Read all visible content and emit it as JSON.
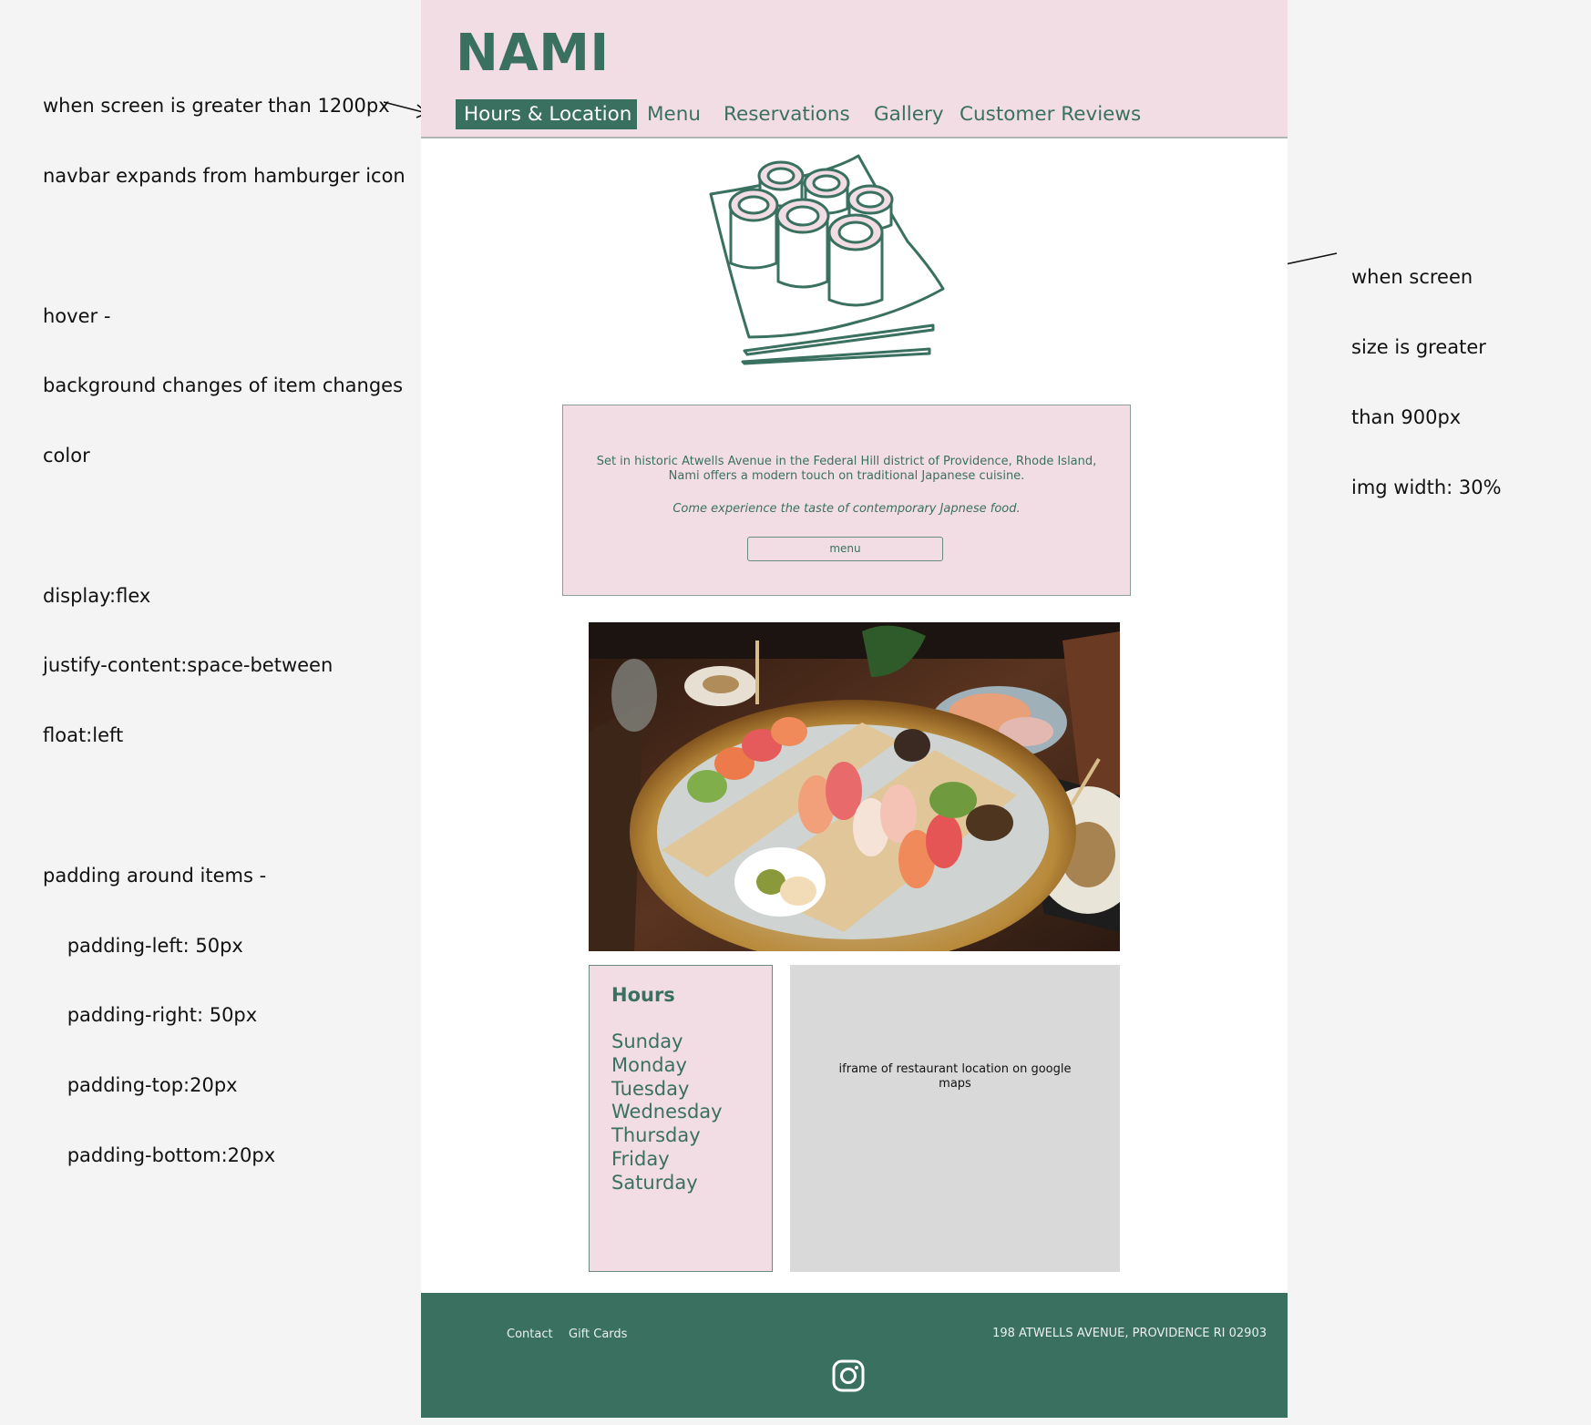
{
  "annotations": {
    "left": [
      "when screen is greater than 1200px",
      "navbar expands from hamburger icon",
      "",
      "hover -",
      "background changes of item changes",
      "color",
      "",
      "display:flex",
      "justify-content:space-between",
      "float:left",
      "",
      "padding around items -",
      "    padding-left: 50px",
      "    padding-right: 50px",
      "    padding-top:20px",
      "    padding-bottom:20px"
    ],
    "right": [
      "when screen",
      "size is greater",
      "than 900px",
      "img width: 30%"
    ]
  },
  "header": {
    "logo": "NAMI",
    "nav": [
      {
        "label": "Hours & Location",
        "active": true
      },
      {
        "label": "Menu",
        "active": false
      },
      {
        "label": "Reservations",
        "active": false
      },
      {
        "label": "Gallery",
        "active": false
      },
      {
        "label": "Customer Reviews",
        "active": false
      }
    ]
  },
  "intro": {
    "text": "Set in historic Atwells Avenue in the Federal Hill district of Providence, Rhode Island, Nami offers a modern touch on traditional Japanese cuisine.",
    "tagline": "Come experience the taste of contemporary Japnese food.",
    "button": "menu"
  },
  "hours": {
    "title": "Hours",
    "days": [
      "Sunday",
      "Monday",
      "Tuesday",
      "Wednesday",
      "Thursday",
      "Friday",
      "Saturday"
    ]
  },
  "map": {
    "placeholder": "iframe of restaurant location on google maps"
  },
  "footer": {
    "links": [
      "Contact",
      "Gift Cards"
    ],
    "address": "198 ATWELLS AVENUE, PROVIDENCE RI 02903",
    "social_icon": "instagram-icon"
  },
  "colors": {
    "brand_green": "#3a7060",
    "brand_pink": "#f3dde4",
    "map_gray": "#d9d9d9"
  }
}
